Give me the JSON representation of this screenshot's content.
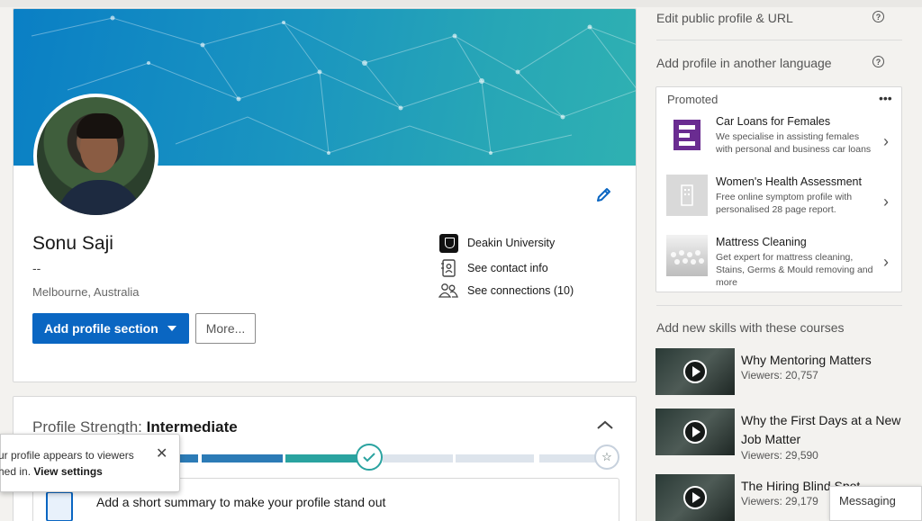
{
  "profile": {
    "name": "Sonu Saji",
    "headline": "--",
    "location": "Melbourne, Australia",
    "add_section_label": "Add profile section",
    "more_label": "More...",
    "education": "Deakin University",
    "contact_label": "See contact info",
    "connections_label": "See connections (10)"
  },
  "strength": {
    "label": "Profile Strength: ",
    "level": "Intermediate",
    "summary_prompt": "Add a short summary to make your profile stand out"
  },
  "toast": {
    "line1": "ur profile appears to viewers",
    "line2_prefix": "hed in. ",
    "line2_link": "View settings"
  },
  "right": {
    "edit_public_profile": "Edit public profile & URL",
    "add_language": "Add profile in another language",
    "promoted_label": "Promoted",
    "ads": [
      {
        "title": "Car Loans for Females",
        "desc": "We specialise in assisting females with personal and business car loans"
      },
      {
        "title": "Women's Health Assessment",
        "desc": "Free online symptom profile with personalised 28 page report."
      },
      {
        "title": "Mattress Cleaning",
        "desc": "Get expert for mattress cleaning, Stains, Germs & Mould removing and more"
      }
    ],
    "courses_title": "Add new skills with these courses",
    "courses": [
      {
        "title": "Why Mentoring Matters",
        "viewers": "Viewers: 20,757"
      },
      {
        "title": "Why the First Days at a New Job Matter",
        "viewers": "Viewers: 29,590"
      },
      {
        "title": "The Hiring Blind Spot",
        "viewers": "Viewers: 29,179"
      }
    ],
    "messaging": "Messaging"
  },
  "colors": {
    "primary": "#0a66c2",
    "strength_teal": "#2aa3a0",
    "strength_blue": "#2c7bb6",
    "track": "#dde4ec"
  }
}
